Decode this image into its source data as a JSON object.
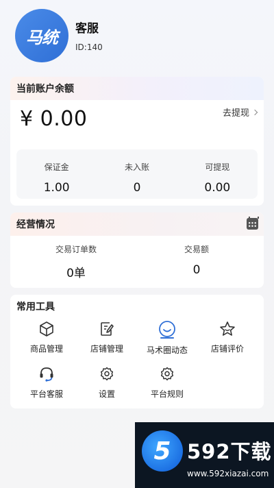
{
  "profile": {
    "avatar_text": "马统",
    "name": "客服",
    "id_text": "ID:140"
  },
  "balance": {
    "title": "当前账户余额",
    "amount": "¥ 0.00",
    "withdraw_label": "去提现",
    "stats": [
      {
        "label": "保证金",
        "value": "1.00"
      },
      {
        "label": "未入账",
        "value": "0"
      },
      {
        "label": "可提现",
        "value": "0.00"
      }
    ]
  },
  "business": {
    "title": "经营情况",
    "stats": [
      {
        "label": "交易订单数",
        "value": "0单"
      },
      {
        "label": "交易额",
        "value": "0"
      }
    ]
  },
  "tools": {
    "title": "常用工具",
    "items": [
      {
        "label": "商品管理",
        "icon": "box-icon"
      },
      {
        "label": "店铺管理",
        "icon": "edit-icon"
      },
      {
        "label": "马术圈动态",
        "icon": "smile-icon"
      },
      {
        "label": "店铺评价",
        "icon": "star-icon"
      },
      {
        "label": "平台客服",
        "icon": "headset-icon"
      },
      {
        "label": "设置",
        "icon": "gear-icon"
      },
      {
        "label": "平台规则",
        "icon": "gear-icon"
      }
    ]
  },
  "watermark": {
    "logo_text": "5",
    "title": "592下载",
    "url": "www.592xiazai.com"
  },
  "colors": {
    "accent_blue": "#2f6fd6",
    "background": "#f3f4f7"
  }
}
